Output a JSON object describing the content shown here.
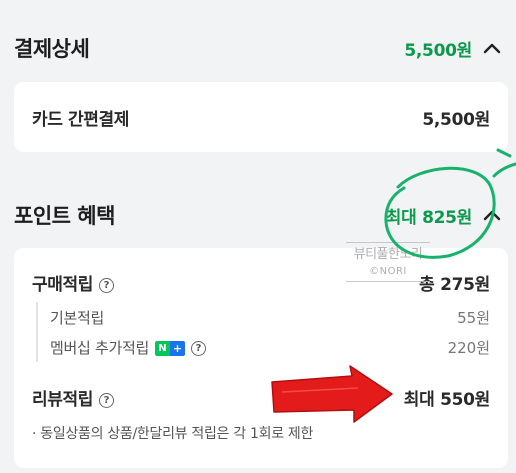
{
  "payment_detail": {
    "title": "결제상세",
    "total": "5,500원",
    "method_label": "카드 간편결제",
    "method_amount": "5,500원"
  },
  "point_benefit": {
    "title": "포인트 혜택",
    "max": "최대 825원",
    "purchase": {
      "label": "구매적립",
      "total": "총 275원",
      "items": [
        {
          "label": "기본적립",
          "value": "55원"
        },
        {
          "label": "멤버십 추가적립",
          "value": "220원"
        }
      ]
    },
    "review": {
      "label": "리뷰적립",
      "value": "최대 550원",
      "note": "· 동일상품의 상품/한달리뷰 적립은 각 1회로 제한"
    }
  },
  "badge": {
    "n": "N",
    "plus": "+"
  },
  "watermark": {
    "line1": "뷰티풀한노리",
    "line2": "©NORI"
  },
  "colors": {
    "accent_green": "#0b9a4b",
    "annotation_red": "#e31b1b",
    "annotation_green": "#17b36b",
    "background": "#f2f3f5",
    "card": "#ffffff"
  },
  "icons": [
    "chevron-up-icon",
    "question-circle-icon",
    "naver-plus-badge"
  ]
}
